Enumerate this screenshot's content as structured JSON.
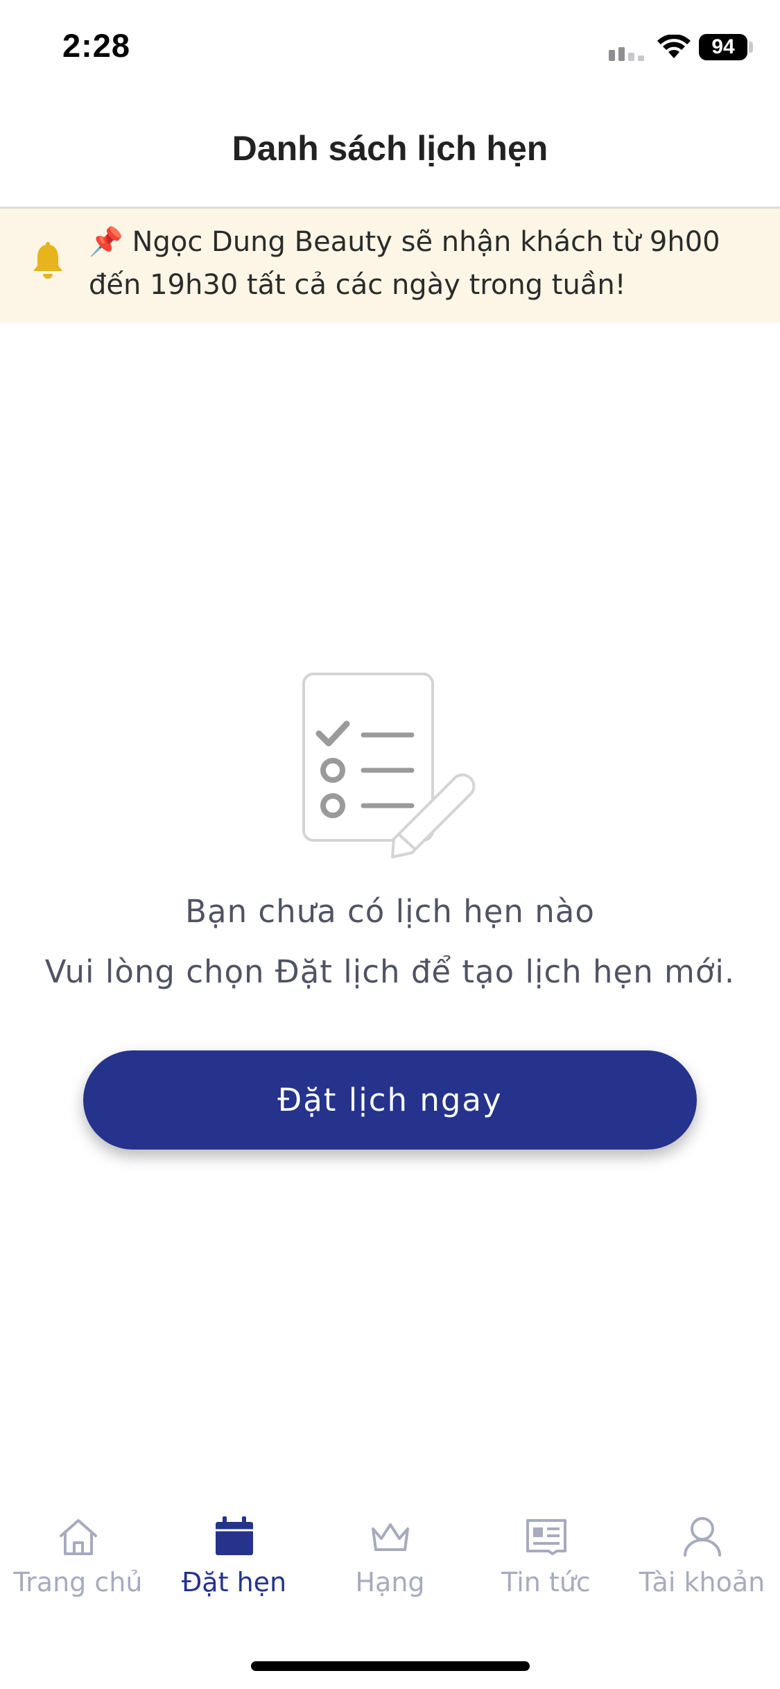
{
  "status_bar": {
    "time": "2:28",
    "battery": "94",
    "icons": [
      "signal-icon",
      "wifi-icon",
      "battery-icon"
    ]
  },
  "header": {
    "title": "Danh sách lịch hẹn"
  },
  "notice": {
    "icon": "bell-icon",
    "pin": "📌",
    "text": "Ngọc Dung Beauty sẽ nhận khách từ 9h00 đến 19h30 tất cả các ngày trong tuần!",
    "background": "#fdf6e6",
    "icon_color": "#e8b41c"
  },
  "empty_state": {
    "illustration": "checklist-pencil-icon",
    "line1": "Bạn chưa có lịch hẹn nào",
    "line2": "Vui lòng chọn Đặt lịch để tạo lịch hẹn mới."
  },
  "primary_action": {
    "label": "Đặt lịch ngay",
    "color": "#25338c"
  },
  "bottom_nav": {
    "active_color": "#25338c",
    "inactive_color": "#a6abbe",
    "items": [
      {
        "label": "Trang chủ",
        "icon": "home-icon",
        "active": false
      },
      {
        "label": "Đặt hẹn",
        "icon": "calendar-icon",
        "active": true
      },
      {
        "label": "Hạng",
        "icon": "crown-icon",
        "active": false
      },
      {
        "label": "Tin tức",
        "icon": "newspaper-icon",
        "active": false
      },
      {
        "label": "Tài khoản",
        "icon": "user-icon",
        "active": false
      }
    ]
  }
}
